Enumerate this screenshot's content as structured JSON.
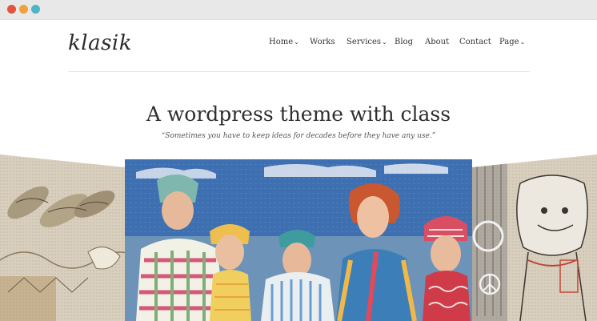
{
  "window": {
    "controls": [
      "close-dot",
      "minimize-dot",
      "maximize-dot"
    ],
    "colors": {
      "close": "#e2543d",
      "minimize": "#f0a13a",
      "maximize": "#4ab6c6"
    }
  },
  "site": {
    "logo": "klasik"
  },
  "nav": {
    "items": [
      {
        "label": "Home",
        "has_dropdown": true
      },
      {
        "label": "Works",
        "has_dropdown": false
      },
      {
        "label": "Services",
        "has_dropdown": true
      },
      {
        "label": "Blog",
        "has_dropdown": false
      },
      {
        "label": "About",
        "has_dropdown": false
      },
      {
        "label": "Contact",
        "has_dropdown": false
      },
      {
        "label": "Page",
        "has_dropdown": true
      }
    ],
    "dropdown_glyph": "⌄"
  },
  "hero": {
    "title": "A wordpress theme with class",
    "quote": "“Sometimes you have to keep ideas for decades before they have any use.”"
  },
  "gallery": {
    "slides": [
      "left-slide-fish-embroidery",
      "center-slide-women-painting",
      "right-slide-figure-sketch"
    ]
  }
}
